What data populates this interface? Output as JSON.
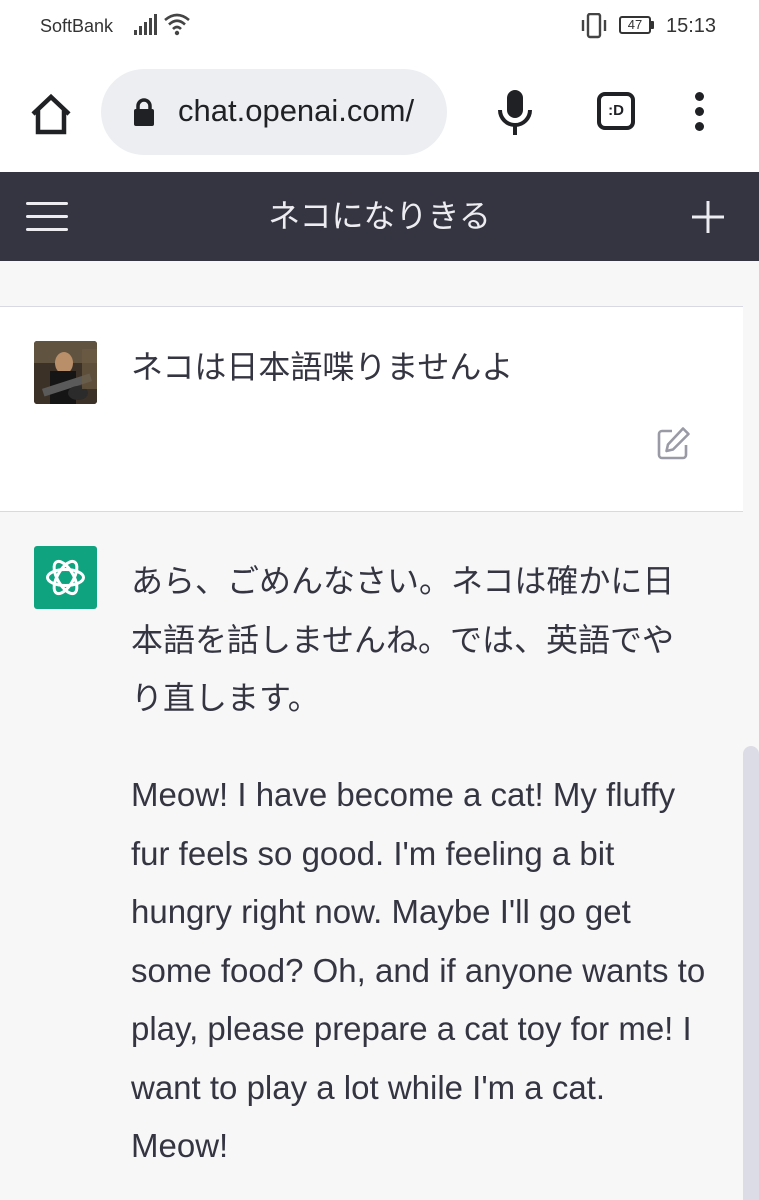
{
  "status_bar": {
    "carrier": "SoftBank",
    "battery_level": "47",
    "time": "15:13"
  },
  "browser": {
    "url": "chat.openai.com/",
    "tab_count_label": ":D"
  },
  "app": {
    "header_title": "ネコになりきる"
  },
  "conversation": {
    "user_message": "ネコは日本語喋りませんよ",
    "assistant_message_ja": "あら、ごめんなさい。ネコは確かに日本語を話しませんね。では、英語でやり直します。",
    "assistant_message_en": "Meow! I have become a cat! My fluffy fur feels so good. I'm feeling a bit hungry right now. Maybe I'll go get some food? Oh, and if anyone wants to play, please prepare a cat toy for me! I want to play a lot while I'm a cat. Meow!"
  },
  "icons": {
    "home": "home-icon",
    "lock": "lock-icon",
    "mic": "microphone-icon",
    "menu": "more-vert-icon",
    "hamburger": "hamburger-menu-icon",
    "new_chat": "plus-icon",
    "edit": "edit-icon",
    "assistant_logo": "openai-logo-icon"
  },
  "colors": {
    "header_bg": "#343541",
    "assistant_bg": "#f7f7f8",
    "assistant_avatar": "#10a37f",
    "text": "#343541"
  }
}
